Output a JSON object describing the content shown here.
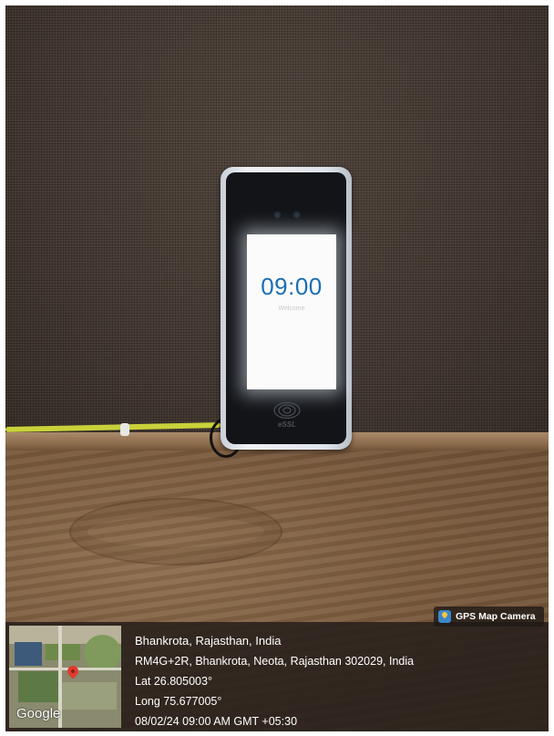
{
  "device": {
    "screen_time": "09:00",
    "screen_subtext": "Welcome",
    "brand": "eSSL"
  },
  "gps_overlay": {
    "badge_label": "GPS Map Camera",
    "map_logo": "Google",
    "location_title": "Bhankrota, Rajasthan, India",
    "address": "RM4G+2R, Bhankrota, Neota, Rajasthan 302029, India",
    "latitude": "Lat 26.805003°",
    "longitude": "Long 75.677005°",
    "timestamp": "08/02/24 09:00 AM GMT +05:30",
    "icons": [
      "gps-map-camera-icon",
      "map-pin-icon"
    ]
  },
  "colors": {
    "screen_time": "#1a6fb3",
    "cable": "#c9d13a",
    "map_pin": "#e03b2f"
  }
}
